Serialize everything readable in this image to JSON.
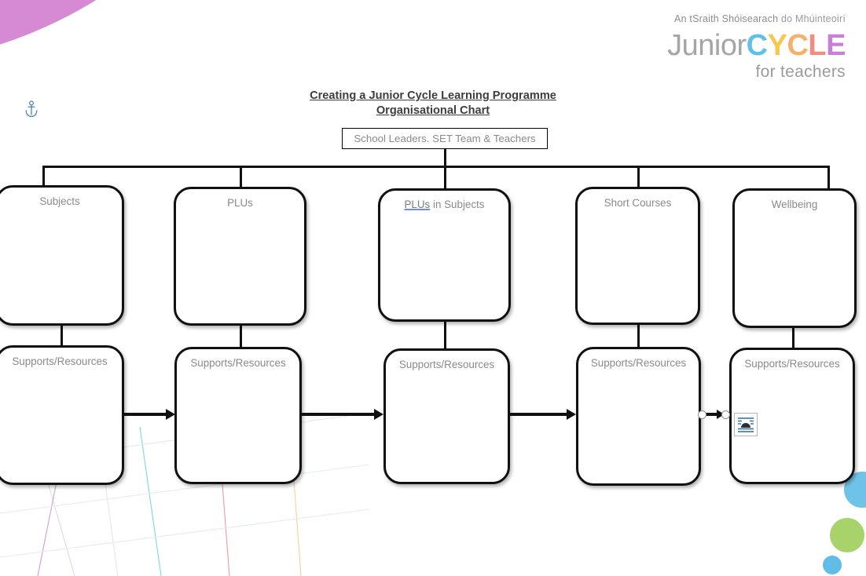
{
  "brand": {
    "tagline_strong": "An tSraith Shóisearach",
    "tagline_light": " do Mhúinteoirí",
    "word_junior": "Junior",
    "word_c1": "C",
    "word_y": "Y",
    "word_c2": "C",
    "word_l": "L",
    "word_e": "E",
    "for_teachers": "for teachers",
    "colors": {
      "c1": "#62c0e8",
      "y": "#f5c850",
      "c2": "#f7b06a",
      "l": "#f08c82",
      "e": "#c97fd6",
      "junior": "#a5a5a5",
      "tagline": "#9a9a9a"
    }
  },
  "document": {
    "title_line1": "Creating a Junior Cycle Learning Programme",
    "title_line2": "Organisational Chart",
    "anchor_icon": "anchor-icon"
  },
  "chart": {
    "root": {
      "label": "School Leaders. SET Team & Teachers"
    },
    "top_row": [
      {
        "label": "Subjects",
        "link_text": "",
        "rest_text": ""
      },
      {
        "label": "PLUs",
        "link_text": "",
        "rest_text": ""
      },
      {
        "label": "PLUs in Subjects",
        "link_text": "PLUs",
        "rest_text": " in Subjects"
      },
      {
        "label": "Short Courses",
        "link_text": "",
        "rest_text": ""
      },
      {
        "label": "Wellbeing",
        "link_text": "",
        "rest_text": ""
      }
    ],
    "bottom_row": [
      {
        "label": "Supports/Resources"
      },
      {
        "label": "Supports/Resources"
      },
      {
        "label": "Supports/Resources"
      },
      {
        "label": "Supports/Resources"
      },
      {
        "label": "Supports/Resources"
      }
    ],
    "selection": {
      "connector_name": "selected-connector",
      "handle_left": "resize-handle-left",
      "handle_right": "resize-handle-right",
      "layout_options_icon": "text-wrap-layout-options-icon"
    },
    "colors": {
      "box_border": "#111111",
      "box_fill": "#ffffff",
      "label_text": "#8a8a8a",
      "link_underline": "#6c8fd6"
    }
  },
  "decoration": {
    "corner_blob": "#d68ad4",
    "circle_blue_large": "#70c3e8",
    "circle_green": "#a8d26a",
    "circle_blue_small": "#62bce8"
  }
}
